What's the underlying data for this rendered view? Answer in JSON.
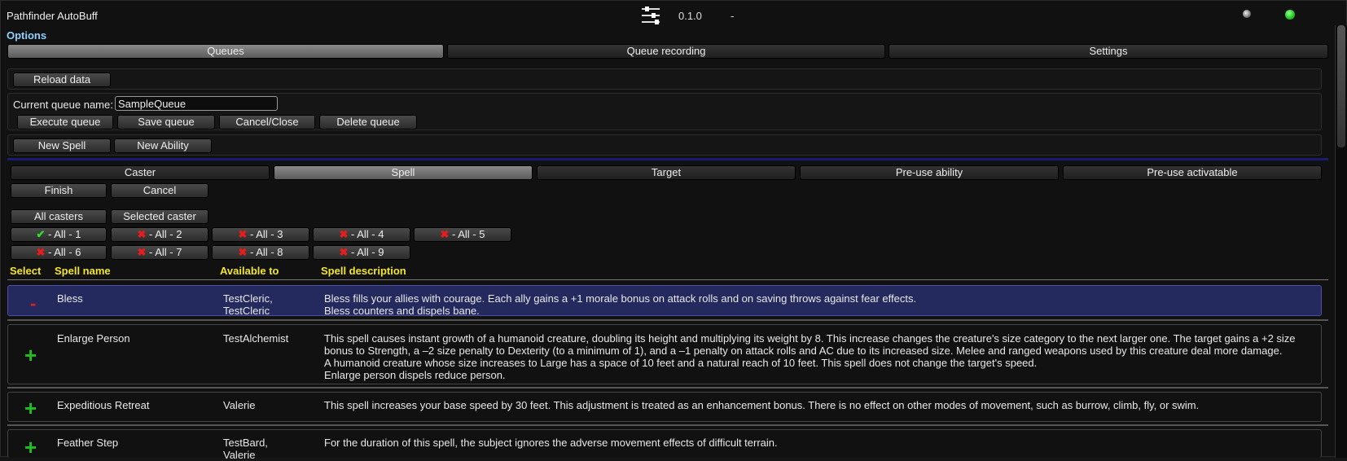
{
  "header": {
    "title": "Pathfinder AutoBuff",
    "version": "0.1.0",
    "dash": "-",
    "options_label": "Options"
  },
  "main_tabs": [
    {
      "label": "Queues",
      "active": true
    },
    {
      "label": "Queue recording",
      "active": false
    },
    {
      "label": "Settings",
      "active": false
    }
  ],
  "toolbar": {
    "reload_label": "Reload data",
    "queue_name_label": "Current queue name:",
    "queue_name_value": "SampleQueue",
    "execute_label": "Execute queue",
    "save_label": "Save queue",
    "cancel_close_label": "Cancel/Close",
    "delete_label": "Delete queue",
    "new_spell_label": "New Spell",
    "new_ability_label": "New Ability"
  },
  "wizard_tabs": [
    {
      "label": "Caster",
      "active": false
    },
    {
      "label": "Spell",
      "active": true
    },
    {
      "label": "Target",
      "active": false
    },
    {
      "label": "Pre-use ability",
      "active": false
    },
    {
      "label": "Pre-use activatable",
      "active": false
    }
  ],
  "wizard_actions": {
    "finish_label": "Finish",
    "cancel_label": "Cancel"
  },
  "caster_filter": {
    "all_label": "All casters",
    "selected_label": "Selected caster"
  },
  "levels": [
    {
      "label": " - All - 1",
      "selected": true
    },
    {
      "label": " - All - 2",
      "selected": false
    },
    {
      "label": " - All - 3",
      "selected": false
    },
    {
      "label": " - All - 4",
      "selected": false
    },
    {
      "label": " - All - 5",
      "selected": false
    },
    {
      "label": " - All - 6",
      "selected": false
    },
    {
      "label": " - All - 7",
      "selected": false
    },
    {
      "label": " - All - 8",
      "selected": false
    },
    {
      "label": " - All - 9",
      "selected": false
    }
  ],
  "table": {
    "headers": [
      "Select",
      "Spell name",
      "Available to",
      "Spell description"
    ],
    "rows": [
      {
        "selected": true,
        "action": "-",
        "name": "Bless",
        "available": [
          "TestCleric,",
          "TestCleric"
        ],
        "description": [
          "Bless fills your allies with courage. Each ally gains a +1 morale bonus on attack rolls and on saving throws against fear effects.",
          "Bless counters and dispels bane."
        ]
      },
      {
        "selected": false,
        "action": "+",
        "name": "Enlarge Person",
        "available": [
          "TestAlchemist"
        ],
        "description": [
          "This spell causes instant growth of a humanoid creature, doubling its height and multiplying its weight by 8. This increase changes the creature's size category to the next larger one. The target gains a +2 size",
          "bonus to Strength, a –2 size penalty to Dexterity (to a minimum of 1), and a –1 penalty on attack rolls and AC due to its increased size. Melee and ranged weapons used by this creature deal more damage.",
          "A humanoid creature whose size increases to Large has a space of 10 feet and a natural reach of 10 feet. This spell does not change the target's speed.",
          "Enlarge person dispels reduce person."
        ]
      },
      {
        "selected": false,
        "action": "+",
        "name": "Expeditious Retreat",
        "available": [
          "Valerie"
        ],
        "description": [
          "This spell increases your base speed by 30 feet. This adjustment is treated as an enhancement bonus. There is no effect on other modes of movement, such as burrow, climb, fly, or swim."
        ]
      },
      {
        "selected": false,
        "action": "+",
        "name": "Feather Step",
        "available": [
          "TestBard,",
          "Valerie"
        ],
        "description": [
          "For the duration of this spell, the subject ignores the adverse movement effects of difficult terrain."
        ]
      }
    ]
  },
  "icons": {
    "settings": "sliders-icon",
    "record": "record-icon",
    "status": "status-dot-icon",
    "check": "✔",
    "cross": "✖"
  },
  "colors": {
    "header_text": "#f2e52a",
    "options_text": "#8fd0ff",
    "selected_row": "#242a5e",
    "plus": "#1fc01f",
    "minus": "#e02020"
  }
}
